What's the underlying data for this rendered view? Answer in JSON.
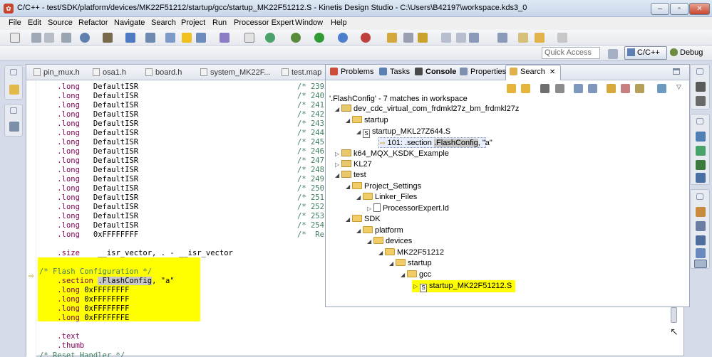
{
  "window": {
    "title": "C/C++ - test/SDK/platform/devices/MK22F51212/startup/gcc/startup_MK22F51212.S - Kinetis Design Studio - C:\\Users\\B42197\\workspace.kds3_0",
    "minimize": "–",
    "maximize": "▫",
    "close": "✕"
  },
  "menu": [
    "File",
    "Edit",
    "Source",
    "Refactor",
    "Navigate",
    "Search",
    "Project",
    "Run",
    "Processor Expert",
    "Window",
    "Help"
  ],
  "perspective": {
    "quick_access_placeholder": "Quick Access",
    "active": "C/C++",
    "other": "Debug"
  },
  "editor": {
    "tabs": [
      "pin_mux.h",
      "osa1.h",
      "board.h",
      "system_MK22F...",
      "test.map"
    ],
    "lines": [
      {
        "indent": "    ",
        "op": ".long",
        "arg": "   DefaultISR",
        "comment": "/* 239"
      },
      {
        "indent": "    ",
        "op": ".long",
        "arg": "   DefaultISR",
        "comment": "/* 240"
      },
      {
        "indent": "    ",
        "op": ".long",
        "arg": "   DefaultISR",
        "comment": "/* 241"
      },
      {
        "indent": "    ",
        "op": ".long",
        "arg": "   DefaultISR",
        "comment": "/* 242"
      },
      {
        "indent": "    ",
        "op": ".long",
        "arg": "   DefaultISR",
        "comment": "/* 243"
      },
      {
        "indent": "    ",
        "op": ".long",
        "arg": "   DefaultISR",
        "comment": "/* 244"
      },
      {
        "indent": "    ",
        "op": ".long",
        "arg": "   DefaultISR",
        "comment": "/* 245"
      },
      {
        "indent": "    ",
        "op": ".long",
        "arg": "   DefaultISR",
        "comment": "/* 246"
      },
      {
        "indent": "    ",
        "op": ".long",
        "arg": "   DefaultISR",
        "comment": "/* 247"
      },
      {
        "indent": "    ",
        "op": ".long",
        "arg": "   DefaultISR",
        "comment": "/* 248"
      },
      {
        "indent": "    ",
        "op": ".long",
        "arg": "   DefaultISR",
        "comment": "/* 249"
      },
      {
        "indent": "    ",
        "op": ".long",
        "arg": "   DefaultISR",
        "comment": "/* 250"
      },
      {
        "indent": "    ",
        "op": ".long",
        "arg": "   DefaultISR",
        "comment": "/* 251"
      },
      {
        "indent": "    ",
        "op": ".long",
        "arg": "   DefaultISR",
        "comment": "/* 252"
      },
      {
        "indent": "    ",
        "op": ".long",
        "arg": "   DefaultISR",
        "comment": "/* 253"
      },
      {
        "indent": "    ",
        "op": ".long",
        "arg": "   DefaultISR",
        "comment": "/* 254"
      },
      {
        "indent": "    ",
        "op": ".long",
        "arg": "   0xFFFFFFFF",
        "comment": "/*  Re"
      }
    ],
    "size_line": {
      "op": ".size",
      "arg": "    __isr_vector, . - __isr_vector"
    },
    "flash_comment": "/* Flash Configuration */",
    "section_line": {
      "op": ".section",
      "sel": ".FlashConfig",
      "rest": ", \"a\""
    },
    "flash_longs": [
      {
        "op": ".long",
        "arg": " 0xFFFFFFFF"
      },
      {
        "op": ".long",
        "arg": " 0xFFFFFFFF"
      },
      {
        "op": ".long",
        "arg": " 0xFFFFFFFF"
      },
      {
        "op": ".long",
        "arg": " 0xFFFFFFFE"
      }
    ],
    "text_line": ".text",
    "thumb_line": ".thumb",
    "last_line": "/* Reset Handler */"
  },
  "search_view": {
    "tabs": [
      "Problems",
      "Tasks",
      "Console",
      "Properties",
      "Search"
    ],
    "summary": "'.FlashConfig' - 7 matches in workspace",
    "tree": {
      "p1": "dev_cdc_virtual_com_frdmkl27z_bm_frdmkl27z",
      "p1_startup": "startup",
      "p1_file": "startup_MKL27Z644.S",
      "match_prefix": "101: .section ",
      "match_term": ".FlashConfig",
      "match_suffix": ", \"a\"",
      "p2": "k64_MQX_KSDK_Example",
      "p3": "KL27",
      "p4": "test",
      "ps": "Project_Settings",
      "lf": "Linker_Files",
      "ld": "ProcessorExpert.ld",
      "sdk": "SDK",
      "platform": "platform",
      "devices": "devices",
      "mk22": "MK22F51212",
      "startup2": "startup",
      "gcc": "gcc",
      "gcc_file": "startup_MK22F51212.S"
    }
  },
  "colors": {
    "highlight": "#ffff00",
    "keyword": "#7f0055",
    "comment": "#3f7f5f"
  }
}
